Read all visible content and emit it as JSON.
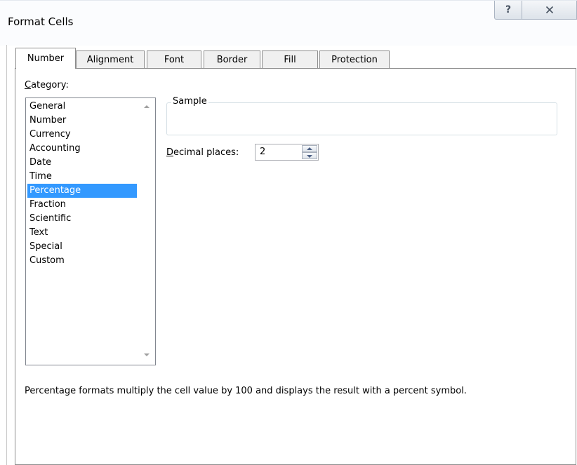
{
  "window": {
    "title": "Format Cells",
    "help_label": "?",
    "close_label": "X"
  },
  "tabs": [
    {
      "label": "Number",
      "active": true
    },
    {
      "label": "Alignment",
      "active": false
    },
    {
      "label": "Font",
      "active": false
    },
    {
      "label": "Border",
      "active": false
    },
    {
      "label": "Fill",
      "active": false
    },
    {
      "label": "Protection",
      "active": false
    }
  ],
  "category": {
    "label_prefix": "C",
    "label_rest": "ategory:",
    "items": [
      "General",
      "Number",
      "Currency",
      "Accounting",
      "Date",
      "Time",
      "Percentage",
      "Fraction",
      "Scientific",
      "Text",
      "Special",
      "Custom"
    ],
    "selected": "Percentage"
  },
  "sample": {
    "label": "Sample",
    "value": ""
  },
  "decimal_places": {
    "label_prefix": "D",
    "label_rest": "ecimal places:",
    "value": "2"
  },
  "description": "Percentage formats multiply the cell value by 100 and displays the result with a percent symbol.",
  "colors": {
    "selection": "#3399ff",
    "panel_border": "#8d8d8d"
  }
}
